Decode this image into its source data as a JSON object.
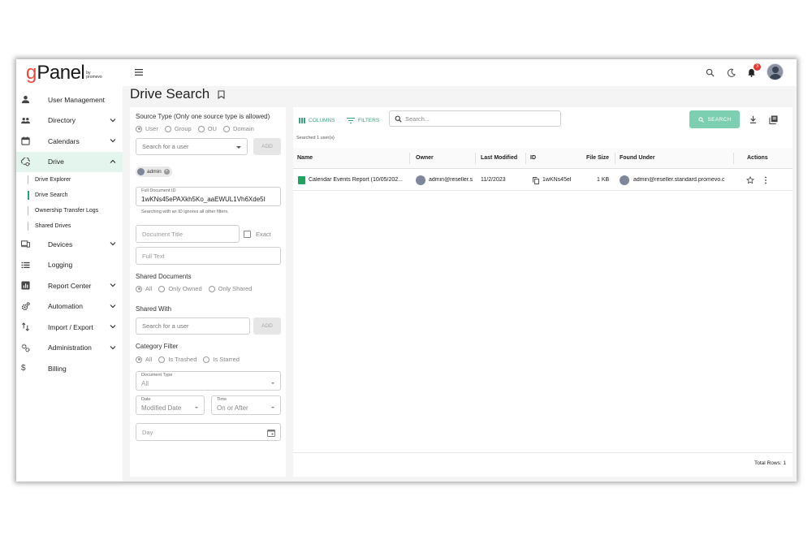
{
  "app": {
    "logo_g": "g",
    "logo_rest": "Panel",
    "logo_sub": "by promevo"
  },
  "sidebar": {
    "items": [
      {
        "label": "User Management",
        "icon": "person-icon",
        "chevron": false
      },
      {
        "label": "Directory",
        "icon": "group-icon",
        "chevron": true
      },
      {
        "label": "Calendars",
        "icon": "calendar-icon",
        "chevron": true
      },
      {
        "label": "Drive",
        "icon": "drive-icon",
        "chevron": true,
        "active": true
      },
      {
        "label": "Devices",
        "icon": "devices-icon",
        "chevron": true
      },
      {
        "label": "Logging",
        "icon": "list-icon",
        "chevron": false
      },
      {
        "label": "Report Center",
        "icon": "report-icon",
        "chevron": true
      },
      {
        "label": "Automation",
        "icon": "gear-icon",
        "chevron": true
      },
      {
        "label": "Import / Export",
        "icon": "import-export-icon",
        "chevron": true
      },
      {
        "label": "Administration",
        "icon": "admin-gears-icon",
        "chevron": true
      },
      {
        "label": "Billing",
        "icon": "dollar-icon",
        "chevron": false
      }
    ],
    "drive_sub": [
      {
        "label": "Drive Explorer"
      },
      {
        "label": "Drive Search",
        "active": true
      },
      {
        "label": "Ownership Transfer Logs"
      },
      {
        "label": "Shared Drives"
      }
    ]
  },
  "topbar": {
    "notification_count": "3"
  },
  "page": {
    "title": "Drive Search"
  },
  "filters": {
    "source_type_label": "Source Type (Only one source type is allowed)",
    "source_options": [
      "User",
      "Group",
      "OU",
      "Domain"
    ],
    "user_placeholder": "Search for a user",
    "add_label": "ADD",
    "chip_label": "admin",
    "doc_id_label": "Full Document ID",
    "doc_id_value": "1wKNs45ePAXkh5Ko_aaEWUL1Vh6Xde5I",
    "doc_id_hint": "Searching with an ID ignores all other filters.",
    "doc_title_placeholder": "Document Title",
    "exact_label": "Exact",
    "full_text_placeholder": "Full Text",
    "shared_docs_label": "Shared Documents",
    "shared_docs_options": [
      "All",
      "Only Owned",
      "Only Shared"
    ],
    "shared_with_label": "Shared With",
    "shared_with_placeholder": "Search for a user",
    "category_label": "Category Filter",
    "category_options": [
      "All",
      "Is Trashed",
      "Is Starred"
    ],
    "doc_type_label": "Document Type",
    "doc_type_value": "All",
    "date_label": "Date",
    "date_value": "Modified Date",
    "time_label": "Time",
    "time_value": "On or After",
    "day_placeholder": "Day"
  },
  "results": {
    "columns_btn": "COLUMNS",
    "filters_btn": "FILTERS",
    "search_placeholder": "Search...",
    "search_btn": "SEARCH",
    "searched_text": "Searched 1 user(s)",
    "headers": {
      "name": "Name",
      "owner": "Owner",
      "last_modified": "Last Modified",
      "id": "ID",
      "file_size": "File Size",
      "found_under": "Found Under",
      "actions": "Actions"
    },
    "rows": [
      {
        "name": "Calendar Events Report (10/05/202...",
        "owner": "admin@reseller.s",
        "last_modified": "11/2/2023",
        "id": "1wKNs45el",
        "file_size": "1 KB",
        "found_under": "admin@reseller.standard.promevo.c"
      }
    ],
    "total_rows": "Total Rows: 1"
  }
}
